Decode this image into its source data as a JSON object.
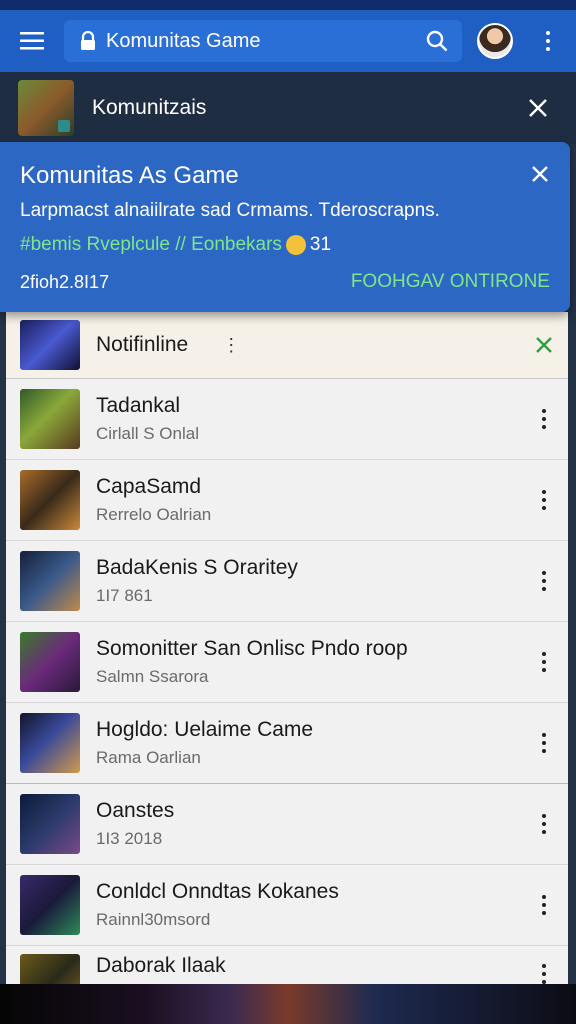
{
  "appbar": {
    "search_query": "Komunitas Game"
  },
  "notification_bar": {
    "title": "Komunitzais"
  },
  "card": {
    "title": "Komunitas As Game",
    "description": "Larpmacst alnaiilrate sad Crmams. Tderoscrapns.",
    "tags": "#bemis Rveplcule // Eonbekars",
    "count": "31",
    "date": "2fioh2.8I17",
    "action": "FOOHGAV ONTIRONE"
  },
  "list": {
    "highlight": {
      "title": "Notifinline",
      "dots": "⋮"
    },
    "items": [
      {
        "title": "Tadankal",
        "subtitle": "Cirlall S Onlal"
      },
      {
        "title": "CapaSamd",
        "subtitle": "Rerrelo Oalrian"
      },
      {
        "title": "BadaKenis S Oraritey",
        "subtitle": "1I7 861"
      },
      {
        "title": "Somonitter San Onlisc Pndo roop",
        "subtitle": "Salmn Ssarora"
      },
      {
        "title": "Hogldo: Uelaime Came",
        "subtitle": "Rama Oarlian"
      },
      {
        "title": "Oanstes",
        "subtitle": "1I3 2018"
      },
      {
        "title": "Conldcl Onndtas Kokanes",
        "subtitle": "Rainnl30msord"
      },
      {
        "title": "Daborak Ilaak",
        "subtitle": ""
      }
    ]
  },
  "colors": {
    "appbar": "#1f5fc4",
    "card": "#2d67c4",
    "accent_green": "#7ee68c",
    "close_green": "#2e9e3e"
  }
}
